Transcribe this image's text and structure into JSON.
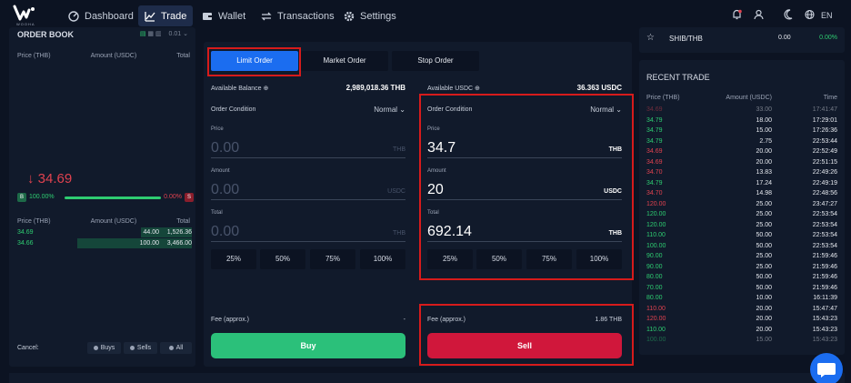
{
  "logo": {
    "sub": "WOOHA"
  },
  "nav": {
    "items": [
      {
        "label": "Dashboard",
        "icon": "dashboard-icon"
      },
      {
        "label": "Trade",
        "icon": "chart-line-icon",
        "active": true
      },
      {
        "label": "Wallet",
        "icon": "wallet-icon"
      },
      {
        "label": "Transactions",
        "icon": "transfer-icon"
      },
      {
        "label": "Settings",
        "icon": "gear-icon"
      }
    ],
    "lang": "EN"
  },
  "orderbook": {
    "title": "ORDER BOOK",
    "precision": "0.01",
    "headers": {
      "price": "Price (THB)",
      "amount": "Amount (USDC)",
      "total": "Total"
    },
    "last_price": "↓ 34.69",
    "ratio": {
      "buy_label": "B",
      "buy_pct": "100.00%",
      "sell_pct": "0.00%",
      "sell_label": "S",
      "buy_fraction": 1.0
    },
    "bids": [
      {
        "price": "34.69",
        "amount": "44.00",
        "total": "1,526.36",
        "depth": 0.3
      },
      {
        "price": "34.66",
        "amount": "100.00",
        "total": "3,466.00",
        "depth": 0.65
      }
    ],
    "cancel": {
      "label": "Cancel:",
      "buys": "Buys",
      "sells": "Sells",
      "all": "All"
    }
  },
  "tabs": [
    "Limit Order",
    "Market Order",
    "Stop Order"
  ],
  "buy": {
    "balance_label": "Available Balance",
    "balance_value": "2,989,018.36 THB",
    "condition_label": "Order Condition",
    "condition_value": "Normal",
    "price_label": "Price",
    "price_value": "0.00",
    "price_unit": "THB",
    "amount_label": "Amount",
    "amount_value": "0.00",
    "amount_unit": "USDC",
    "total_label": "Total",
    "total_value": "0.00",
    "total_unit": "THB",
    "fee_label": "Fee (approx.)",
    "fee_value": "-",
    "button": "Buy"
  },
  "sell": {
    "balance_label": "Available USDC",
    "balance_value": "36.363 USDC",
    "condition_label": "Order Condition",
    "condition_value": "Normal",
    "price_label": "Price",
    "price_value": "34.7",
    "price_unit": "THB",
    "amount_label": "Amount",
    "amount_value": "20",
    "amount_unit": "USDC",
    "total_label": "Total",
    "total_value": "692.14",
    "total_unit": "THB",
    "fee_label": "Fee (approx.)",
    "fee_value": "1.86 THB",
    "button": "Sell"
  },
  "percents": [
    "25%",
    "50%",
    "75%",
    "100%"
  ],
  "favorite": {
    "symbol": "SHIB/THB",
    "price": "0.00",
    "change": "0.00%"
  },
  "recent_trade": {
    "title": "RECENT TRADE",
    "headers": {
      "price": "Price (THB)",
      "amount": "Amount (USDC)",
      "time": "Time"
    },
    "rows": [
      {
        "price": "34.69",
        "amount": "33.00",
        "time": "17:41:47",
        "side": "dn"
      },
      {
        "price": "34.79",
        "amount": "18.00",
        "time": "17:29:01",
        "side": "up"
      },
      {
        "price": "34.79",
        "amount": "15.00",
        "time": "17:26:36",
        "side": "up"
      },
      {
        "price": "34.79",
        "amount": "2.75",
        "time": "22:53:44",
        "side": "up"
      },
      {
        "price": "34.69",
        "amount": "20.00",
        "time": "22:52:49",
        "side": "dn"
      },
      {
        "price": "34.69",
        "amount": "20.00",
        "time": "22:51:15",
        "side": "dn"
      },
      {
        "price": "34.70",
        "amount": "13.83",
        "time": "22:49:26",
        "side": "dn"
      },
      {
        "price": "34.79",
        "amount": "17.24",
        "time": "22:49:19",
        "side": "up"
      },
      {
        "price": "34.70",
        "amount": "14.98",
        "time": "22:48:56",
        "side": "dn"
      },
      {
        "price": "120.00",
        "amount": "25.00",
        "time": "23:47:27",
        "side": "dn"
      },
      {
        "price": "120.00",
        "amount": "25.00",
        "time": "22:53:54",
        "side": "up"
      },
      {
        "price": "120.00",
        "amount": "25.00",
        "time": "22:53:54",
        "side": "up"
      },
      {
        "price": "110.00",
        "amount": "50.00",
        "time": "22:53:54",
        "side": "up"
      },
      {
        "price": "100.00",
        "amount": "50.00",
        "time": "22:53:54",
        "side": "up"
      },
      {
        "price": "90.00",
        "amount": "25.00",
        "time": "21:59:46",
        "side": "up"
      },
      {
        "price": "90.00",
        "amount": "25.00",
        "time": "21:59:46",
        "side": "up"
      },
      {
        "price": "80.00",
        "amount": "50.00",
        "time": "21:59:46",
        "side": "up"
      },
      {
        "price": "70.00",
        "amount": "50.00",
        "time": "21:59:46",
        "side": "up"
      },
      {
        "price": "80.00",
        "amount": "10.00",
        "time": "16:11:39",
        "side": "up"
      },
      {
        "price": "110.00",
        "amount": "20.00",
        "time": "15:47:47",
        "side": "dn"
      },
      {
        "price": "120.00",
        "amount": "20.00",
        "time": "15:43:23",
        "side": "dn"
      },
      {
        "price": "110.00",
        "amount": "20.00",
        "time": "15:43:23",
        "side": "up"
      },
      {
        "price": "100.00",
        "amount": "15.00",
        "time": "15:43:23",
        "side": "up"
      }
    ]
  }
}
